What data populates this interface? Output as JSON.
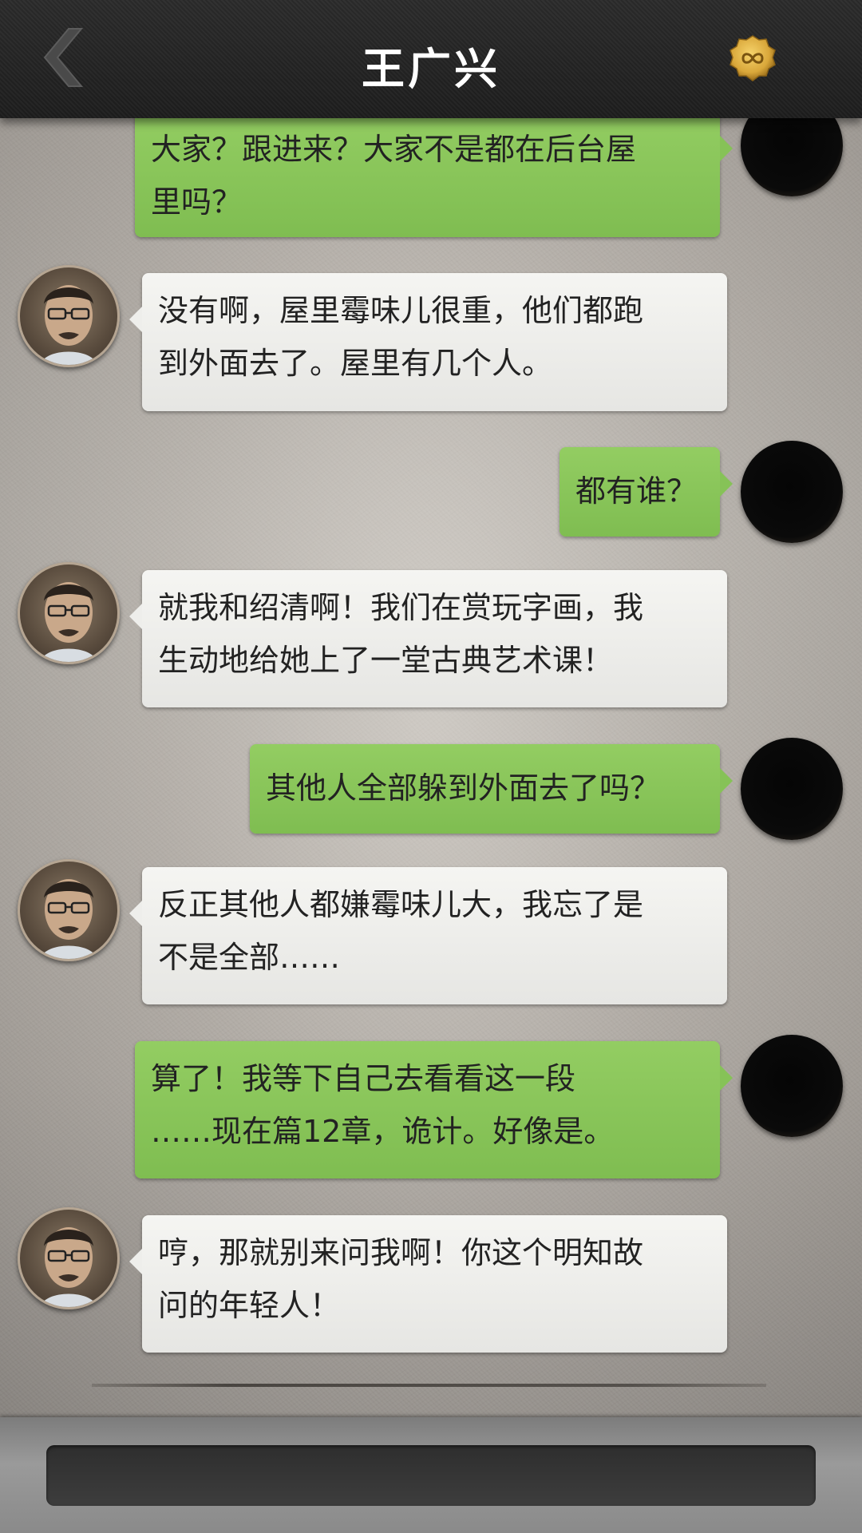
{
  "header": {
    "title": "王广兴",
    "back_icon": "chevron-left-icon",
    "coin_icon": "infinity-coin-icon",
    "coin_color": "#d9a73a"
  },
  "messages": [
    {
      "sender": "player",
      "text": "大家？跟进来？大家不是都在后台屋\n里吗？"
    },
    {
      "sender": "npc",
      "text": "没有啊，屋里霉味儿很重，他们都跑\n到外面去了。屋里有几个人。"
    },
    {
      "sender": "player",
      "text": "都有谁？"
    },
    {
      "sender": "npc",
      "text": "就我和绍清啊！我们在赏玩字画，我\n生动地给她上了一堂古典艺术课！"
    },
    {
      "sender": "player",
      "text": "其他人全部躲到外面去了吗？"
    },
    {
      "sender": "npc",
      "text": "反正其他人都嫌霉味儿大，我忘了是\n不是全部……"
    },
    {
      "sender": "player",
      "text": "算了！我等下自己去看看这一段\n……现在篇12章，诡计。好像是。"
    },
    {
      "sender": "npc",
      "text": "哼，那就别来问我啊！你这个明知故\n问的年轻人！"
    }
  ],
  "footer": {
    "reply_text": ""
  },
  "colors": {
    "player_bubble": "#87c45a",
    "npc_bubble": "#eeeeeb",
    "header_bg": "#222222"
  }
}
